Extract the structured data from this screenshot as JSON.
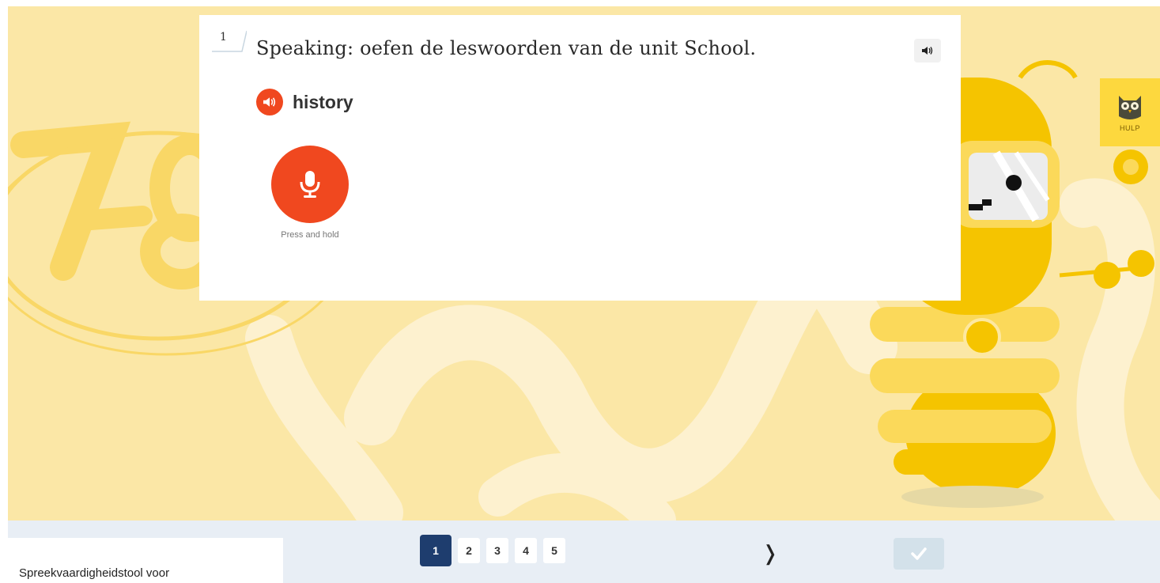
{
  "question": {
    "number": "1",
    "text": "Speaking: oefen de leswoorden van de unit School."
  },
  "word": {
    "text": "history"
  },
  "recorder": {
    "label": "Press and hold"
  },
  "help": {
    "label": "HULP"
  },
  "pagination": {
    "pages": [
      "1",
      "2",
      "3",
      "4",
      "5"
    ],
    "active": "1",
    "next_label": "❭"
  },
  "footer": {
    "caption": "Spreekvaardigheidstool voor"
  },
  "icons": {
    "speaker": "speaker-icon",
    "mic": "microphone-icon",
    "owl": "owl-icon",
    "check": "check-icon"
  },
  "colors": {
    "accent": "#f0481f",
    "active_page": "#1e3d6e",
    "background": "#fbe7a6",
    "help": "#fdd83e",
    "bottom_bar": "#e8eef5"
  }
}
